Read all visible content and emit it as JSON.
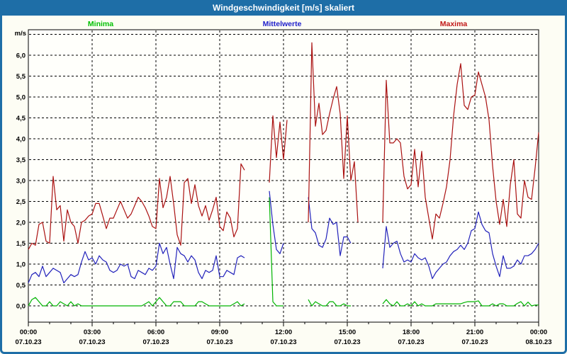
{
  "window": {
    "title": "Windgeschwindigkeit [m/s] skaliert"
  },
  "legend": {
    "items": [
      {
        "label": "Minima",
        "color": "#00c000"
      },
      {
        "label": "Mittelwerte",
        "color": "#2222cc"
      },
      {
        "label": "Maxima",
        "color": "#c01515"
      }
    ]
  },
  "colors": {
    "frame_blue": "#1e6ea7",
    "plot_background": "#fffffb",
    "grid": "#000000"
  },
  "chart_data": {
    "type": "line",
    "title": "Windgeschwindigkeit [m/s] skaliert",
    "y_unit": "m/s",
    "xlabel": "",
    "ylabel": "m/s",
    "grid": "dashed",
    "legend_position": "top",
    "ylim": [
      -0.39,
      6.6
    ],
    "x_range_minutes": [
      0,
      1440
    ],
    "x_step_minutes": 10,
    "x_minor_step_minutes": 60,
    "y_gridlines": [
      0,
      0.5,
      1,
      1.5,
      2,
      2.5,
      3,
      3.5,
      4,
      4.5,
      5,
      5.5,
      6,
      6.5
    ],
    "y_ticks": [
      {
        "value": 6.0,
        "label": "6,0"
      },
      {
        "value": 5.5,
        "label": "5,5"
      },
      {
        "value": 5.0,
        "label": "5,0"
      },
      {
        "value": 4.5,
        "label": "4,5"
      },
      {
        "value": 4.0,
        "label": "4,0"
      },
      {
        "value": 3.5,
        "label": "3,5"
      },
      {
        "value": 3.0,
        "label": "3,0"
      },
      {
        "value": 2.5,
        "label": "2,5"
      },
      {
        "value": 2.0,
        "label": "2,0"
      },
      {
        "value": 1.5,
        "label": "1,5"
      },
      {
        "value": 1.0,
        "label": "1,0"
      },
      {
        "value": 0.5,
        "label": "0,5"
      },
      {
        "value": 0.0,
        "label": "0,0"
      }
    ],
    "x_major_ticks": [
      {
        "minute": 0,
        "time": "00:00",
        "date": "07.10.23"
      },
      {
        "minute": 180,
        "time": "03:00",
        "date": "07.10.23"
      },
      {
        "minute": 360,
        "time": "06:00",
        "date": "07.10.23"
      },
      {
        "minute": 540,
        "time": "09:00",
        "date": "07.10.23"
      },
      {
        "minute": 720,
        "time": "12:00",
        "date": "07.10.23"
      },
      {
        "minute": 900,
        "time": "15:00",
        "date": "07.10.23"
      },
      {
        "minute": 1080,
        "time": "18:00",
        "date": "07.10.23"
      },
      {
        "minute": 1260,
        "time": "21:00",
        "date": "07.10.23"
      },
      {
        "minute": 1440,
        "time": "00:00",
        "date": "08.10.23"
      }
    ],
    "series": [
      {
        "name": "Minima",
        "color": "#00b400",
        "values": [
          0.0,
          0.15,
          0.2,
          0.1,
          0.0,
          0.0,
          0.1,
          0.0,
          0.0,
          0.1,
          0.05,
          0.0,
          0.1,
          0.0,
          0.05,
          0.0,
          0.0,
          0.0,
          0.0,
          0.0,
          0.0,
          0.0,
          0.0,
          0.0,
          0.0,
          0.0,
          0.0,
          0.0,
          0.0,
          0.0,
          0.0,
          0.0,
          0.0,
          0.05,
          0.1,
          0.0,
          0.1,
          0.2,
          0.1,
          0.0,
          0.0,
          0.1,
          0.1,
          0.1,
          0.0,
          0.0,
          0.0,
          0.0,
          0.1,
          0.1,
          0.05,
          0.0,
          0.0,
          0.0,
          0.0,
          0.0,
          0.0,
          0.0,
          0.05,
          0.1,
          0.0,
          0.05,
          null,
          null,
          null,
          null,
          null,
          null,
          2.6,
          0.1,
          0.0,
          0.0,
          0.0,
          null,
          null,
          null,
          null,
          null,
          null,
          0.15,
          0.0,
          0.1,
          0.05,
          0.0,
          0.0,
          0.1,
          0.1,
          0.0,
          0.0,
          0.05,
          0.0,
          0.0,
          null,
          null,
          null,
          null,
          null,
          null,
          null,
          null,
          0.05,
          0.15,
          0.05,
          0.0,
          0.1,
          0.0,
          0.0,
          0.05,
          0.0,
          0.1,
          0.0,
          0.05,
          0.0,
          0.0,
          0.0,
          0.05,
          0.05,
          0.05,
          0.05,
          0.05,
          0.05,
          0.05,
          0.05,
          0.08,
          0.1,
          0.1,
          0.1,
          0.12,
          0.0,
          0.0,
          0.0,
          0.05,
          0.0,
          0.05,
          0.05,
          0.0,
          0.0,
          0.0,
          0.06,
          0.1,
          0.0,
          0.09,
          0.0,
          0.02,
          0.02
        ]
      },
      {
        "name": "Mittelwerte",
        "color": "#2222bb",
        "values": [
          0.55,
          0.75,
          0.8,
          0.7,
          0.95,
          0.7,
          0.8,
          0.9,
          0.85,
          0.8,
          0.55,
          0.65,
          0.75,
          0.7,
          0.75,
          1.05,
          1.3,
          1.1,
          1.15,
          1.0,
          1.2,
          1.1,
          1.05,
          0.85,
          0.8,
          0.85,
          1.0,
          0.95,
          1.0,
          0.7,
          0.65,
          0.85,
          0.8,
          0.75,
          0.9,
          0.85,
          0.95,
          1.5,
          1.25,
          1.4,
          1.0,
          0.65,
          1.4,
          1.25,
          1.2,
          1.05,
          1.2,
          1.1,
          0.8,
          0.65,
          0.85,
          0.8,
          0.85,
          1.2,
          0.7,
          0.7,
          0.85,
          0.8,
          0.75,
          1.15,
          1.2,
          1.15,
          null,
          null,
          null,
          null,
          null,
          null,
          2.75,
          1.95,
          1.35,
          1.25,
          1.5,
          null,
          null,
          null,
          null,
          null,
          null,
          2.6,
          1.85,
          1.75,
          1.45,
          1.4,
          1.6,
          2.1,
          1.95,
          2.0,
          1.2,
          1.65,
          1.65,
          1.5,
          null,
          null,
          null,
          null,
          null,
          null,
          null,
          null,
          0.9,
          1.9,
          1.4,
          1.5,
          1.55,
          1.25,
          1.05,
          1.1,
          1.05,
          1.25,
          1.15,
          1.1,
          1.15,
          0.95,
          0.65,
          0.8,
          0.9,
          1.0,
          1.05,
          1.2,
          1.3,
          1.35,
          1.45,
          1.35,
          1.5,
          1.8,
          1.85,
          2.25,
          1.95,
          1.8,
          1.75,
          1.25,
          0.95,
          0.7,
          1.2,
          0.9,
          0.9,
          0.95,
          1.1,
          1.0,
          1.2,
          1.2,
          1.25,
          1.35,
          1.5
        ]
      },
      {
        "name": "Maxima",
        "color": "#aa1111",
        "values": [
          1.35,
          1.5,
          1.45,
          1.95,
          2.0,
          1.55,
          1.5,
          3.1,
          2.3,
          2.4,
          1.55,
          2.3,
          2.0,
          1.9,
          1.5,
          2.0,
          2.05,
          2.15,
          2.2,
          2.45,
          2.45,
          2.15,
          1.85,
          2.1,
          2.1,
          2.3,
          2.5,
          2.3,
          2.1,
          2.2,
          2.4,
          2.6,
          2.5,
          2.35,
          2.15,
          1.9,
          1.85,
          3.05,
          2.35,
          2.6,
          3.1,
          2.45,
          1.7,
          1.45,
          2.95,
          3.05,
          2.45,
          2.9,
          2.4,
          2.15,
          2.4,
          2.05,
          2.3,
          2.6,
          1.9,
          1.8,
          2.25,
          2.1,
          1.65,
          1.85,
          3.4,
          3.25,
          null,
          null,
          null,
          null,
          null,
          null,
          2.95,
          4.55,
          3.55,
          4.4,
          3.5,
          4.45,
          null,
          null,
          null,
          null,
          null,
          2.0,
          6.3,
          4.3,
          4.85,
          4.1,
          4.2,
          4.6,
          4.95,
          5.25,
          4.6,
          3.05,
          4.55,
          3.0,
          3.45,
          2.0,
          null,
          null,
          null,
          null,
          null,
          null,
          2.0,
          5.4,
          3.9,
          3.9,
          4.0,
          3.9,
          3.1,
          2.8,
          2.9,
          3.75,
          2.85,
          3.7,
          2.6,
          2.1,
          1.6,
          2.2,
          2.1,
          2.45,
          2.85,
          3.5,
          4.55,
          5.3,
          5.8,
          4.8,
          4.7,
          5.0,
          5.05,
          5.6,
          5.3,
          5.0,
          4.45,
          3.35,
          2.5,
          1.95,
          2.55,
          1.9,
          2.9,
          3.5,
          2.2,
          2.1,
          3.0,
          2.6,
          2.55,
          3.3,
          4.15
        ]
      }
    ]
  }
}
